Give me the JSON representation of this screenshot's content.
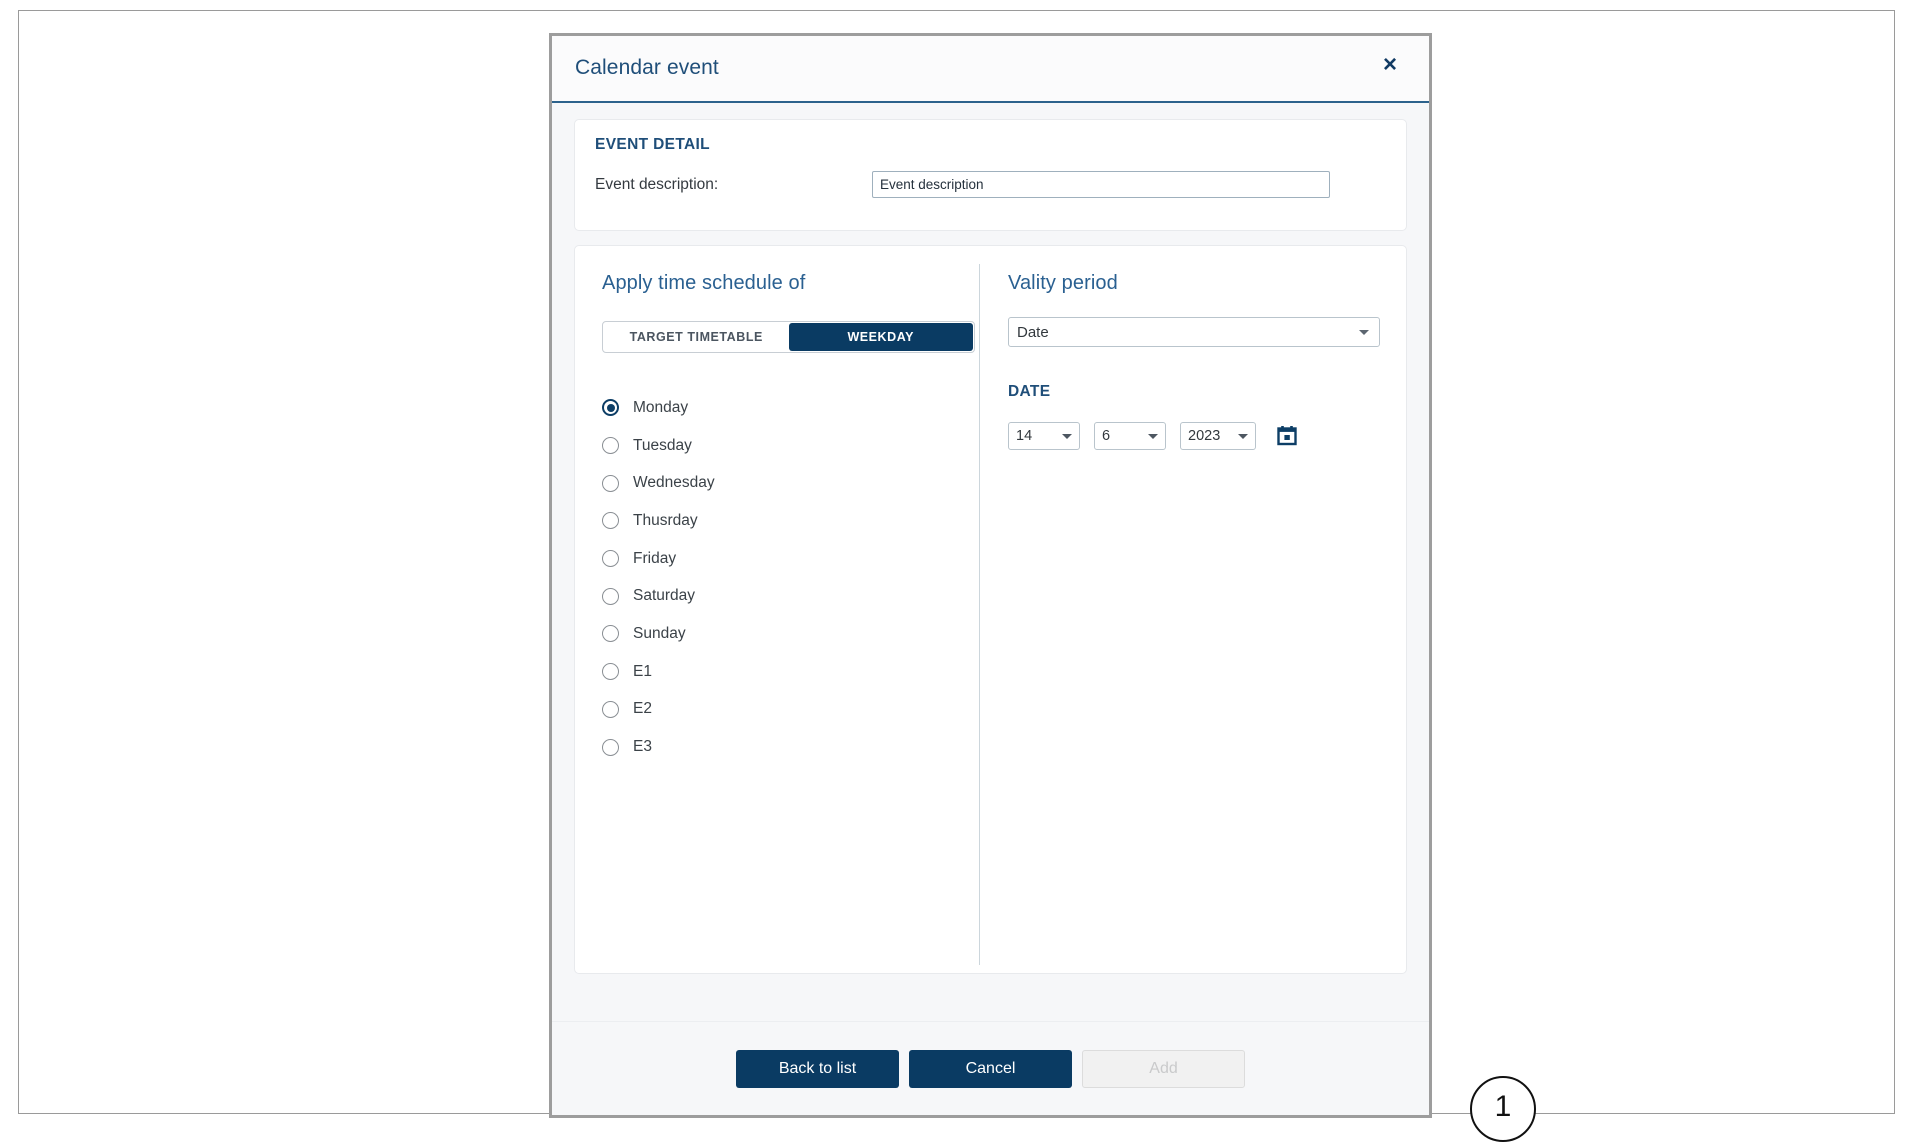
{
  "dialog": {
    "title": "Calendar event",
    "close_label": "×",
    "close_icon": "close-icon"
  },
  "event_detail": {
    "heading": "EVENT DETAIL",
    "description_label": "Event description:",
    "description_value": "Event description",
    "description_placeholder": "Event description"
  },
  "schedule": {
    "heading": "Apply time schedule of",
    "segmented": {
      "options": [
        "TARGET TIMETABLE",
        "WEEKDAY"
      ],
      "selected": "WEEKDAY"
    },
    "radio_group": {
      "selected": "Monday",
      "options": [
        "Monday",
        "Tuesday",
        "Wednesday",
        "Thusrday",
        "Friday",
        "Saturday",
        "Sunday",
        "E1",
        "E2",
        "E3"
      ]
    }
  },
  "validity": {
    "heading": "Vality period",
    "type_select": {
      "value": "Date",
      "options": [
        "Date"
      ]
    },
    "date_heading": "DATE",
    "day": {
      "value": "14",
      "options": [
        "14"
      ]
    },
    "month": {
      "value": "6",
      "options": [
        "6"
      ]
    },
    "year": {
      "value": "2023",
      "options": [
        "2023"
      ]
    },
    "calendar_icon": "calendar-icon"
  },
  "footer": {
    "back_label": "Back to list",
    "cancel_label": "Cancel",
    "add_label": "Add"
  },
  "annotations": {
    "callout_1": "1"
  },
  "colors": {
    "accent_navy": "#0a3b63",
    "heading_blue": "#1f4e79",
    "panel_blue": "#2a6091",
    "dialog_border": "#9d9d9d",
    "body_bg": "#f6f7f9"
  }
}
